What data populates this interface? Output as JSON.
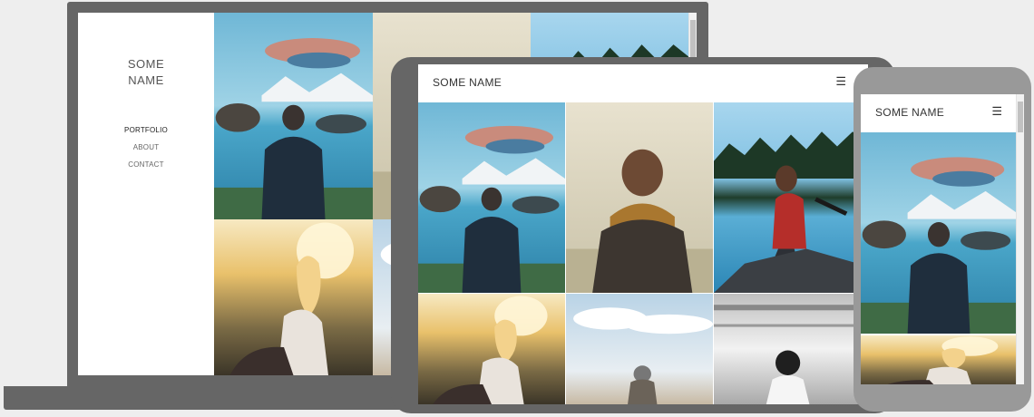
{
  "laptop": {
    "brand_line1": "SOME",
    "brand_line2": "NAME",
    "nav": {
      "portfolio": "PORTFOLIO",
      "about": "ABOUT",
      "contact": "CONTACT"
    }
  },
  "tablet": {
    "brand": "SOME NAME",
    "menu_icon": "☰"
  },
  "phone": {
    "brand": "SOME NAME",
    "menu_icon": "☰"
  },
  "colors": {
    "device_dark": "#666666",
    "device_light": "#999999",
    "background": "#eeeeee"
  }
}
